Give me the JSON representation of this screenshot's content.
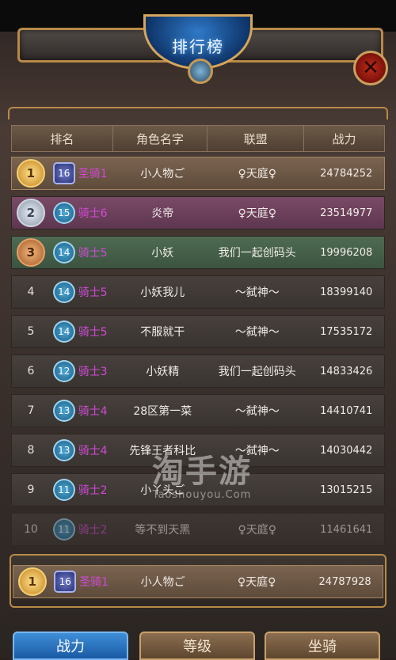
{
  "title": "排行榜",
  "close_icon": "close-icon",
  "columns": [
    "排名",
    "角色名字",
    "联盟",
    "战力"
  ],
  "rows": [
    {
      "rank": "1",
      "medal": "gold",
      "level": "16",
      "title": "圣骑1",
      "name": "小人物ご",
      "guild": "♀天庭♀",
      "power": "24784252"
    },
    {
      "rank": "2",
      "medal": "silver",
      "level": "15",
      "title": "骑士6",
      "name": "炎帝",
      "guild": "♀天庭♀",
      "power": "23514977"
    },
    {
      "rank": "3",
      "medal": "bronze",
      "level": "14",
      "title": "骑士5",
      "name": "小妖",
      "guild": "我们一起创码头",
      "power": "19996208"
    },
    {
      "rank": "4",
      "medal": "",
      "level": "14",
      "title": "骑士5",
      "name": "小妖我儿",
      "guild": "～弑神～",
      "power": "18399140"
    },
    {
      "rank": "5",
      "medal": "",
      "level": "14",
      "title": "骑士5",
      "name": "不服就干",
      "guild": "～弑神～",
      "power": "17535172"
    },
    {
      "rank": "6",
      "medal": "",
      "level": "12",
      "title": "骑士3",
      "name": "小妖精",
      "guild": "我们一起创码头",
      "power": "14833426"
    },
    {
      "rank": "7",
      "medal": "",
      "level": "13",
      "title": "骑士4",
      "name": "28区第一菜",
      "guild": "～弑神～",
      "power": "14410741"
    },
    {
      "rank": "8",
      "medal": "",
      "level": "13",
      "title": "骑士4",
      "name": "先锋王者科比",
      "guild": "～弑神～",
      "power": "14030442"
    },
    {
      "rank": "9",
      "medal": "",
      "level": "11",
      "title": "骑士2",
      "name": "小丫头ご",
      "guild": "",
      "power": "13015215"
    },
    {
      "rank": "10",
      "medal": "",
      "level": "11",
      "title": "骑士2",
      "name": "等不到天黑",
      "guild": "♀天庭♀",
      "power": "11461641"
    }
  ],
  "my_row": {
    "rank": "1",
    "level": "16",
    "title": "圣骑1",
    "name": "小人物ご",
    "guild": "♀天庭♀",
    "power": "24787928"
  },
  "watermark": {
    "big": "淘手游",
    "small": "Taoshouyou.Com"
  },
  "tabs": [
    "战力",
    "等级",
    "坐骑"
  ],
  "colors": {
    "title_pink": "#d04ad6",
    "gold_frame": "#b88a48",
    "active_tab": "#1a5aa4"
  }
}
